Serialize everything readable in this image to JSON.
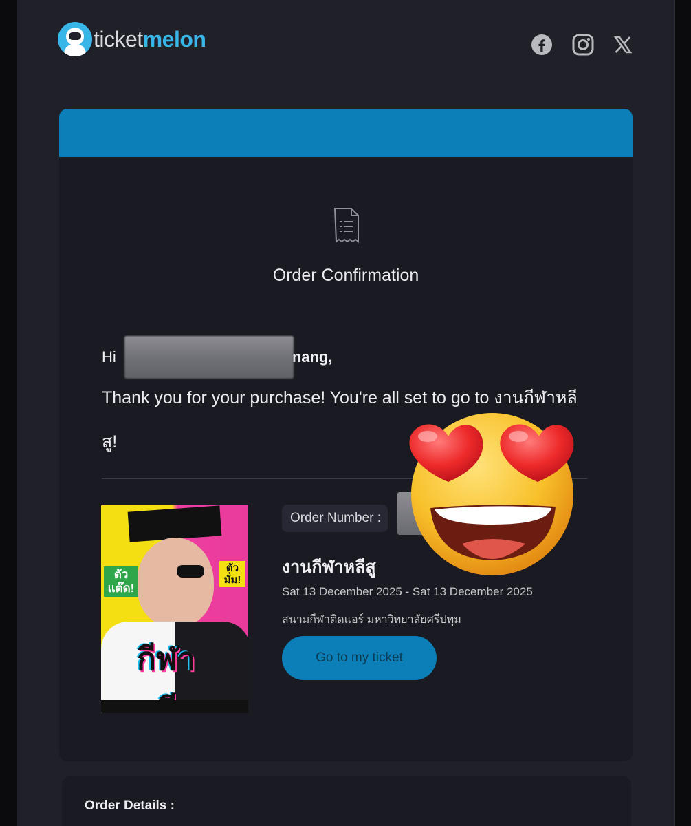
{
  "brand": {
    "name_part1": "ticket",
    "name_part2": "melon",
    "accent": "#39b6e8"
  },
  "social": [
    "facebook-icon",
    "instagram-icon",
    "x-icon"
  ],
  "confirmation": {
    "icon": "receipt-icon",
    "title": "Order Confirmation"
  },
  "greeting": {
    "hi": "Hi",
    "name_visible_end": "nang,",
    "thanks": "Thank you for your purchase! You're all set to go to งานกีฬาหลีสู!"
  },
  "order": {
    "number_label": "Order Number :",
    "event_title": "งานกีฬาหลีสู",
    "date_range": "Sat 13 December 2025 - Sat 13 December 2025",
    "venue": "สนามกีฬาติดแอร์ มหาวิทยาลัยศรีปทุม",
    "ticket_button": "Go to my ticket"
  },
  "poster": {
    "tag_left": "ตัว แต๊ด!",
    "tag_right": "ตัว มั่ม!",
    "logo_text": "กีฬาหลีสู"
  },
  "details": {
    "title": "Order Details :"
  },
  "colors": {
    "header_bar": "#0c7fb8",
    "background": "#1f2028",
    "card": "#1a1b22"
  }
}
